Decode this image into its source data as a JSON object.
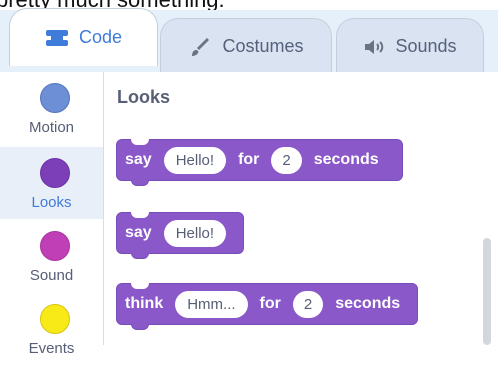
{
  "top_partial_text": "pretty much something.",
  "tabs": [
    {
      "label": "Code",
      "icon": "code-icon",
      "active": true
    },
    {
      "label": "Costumes",
      "icon": "brush-icon",
      "active": false
    },
    {
      "label": "Sounds",
      "icon": "speaker-icon",
      "active": false
    }
  ],
  "categories": [
    {
      "label": "Motion",
      "color": "#4c7fd4"
    },
    {
      "label": "Looks",
      "color": "#8a58c8",
      "selected": true
    },
    {
      "label": "Sound",
      "color": "#c44bc8"
    },
    {
      "label": "Events",
      "color": "#f6e21b"
    }
  ],
  "section_title": "Looks",
  "blocks": [
    {
      "parts": [
        "say",
        "Hello!",
        "for",
        "2",
        "seconds"
      ]
    },
    {
      "parts": [
        "say",
        "Hello!"
      ]
    },
    {
      "parts": [
        "think",
        "Hmm...",
        "for",
        "2",
        "seconds"
      ]
    }
  ],
  "colors": {
    "looks_block": "#8a58c8",
    "active_tab_text": "#3f7bd8"
  }
}
